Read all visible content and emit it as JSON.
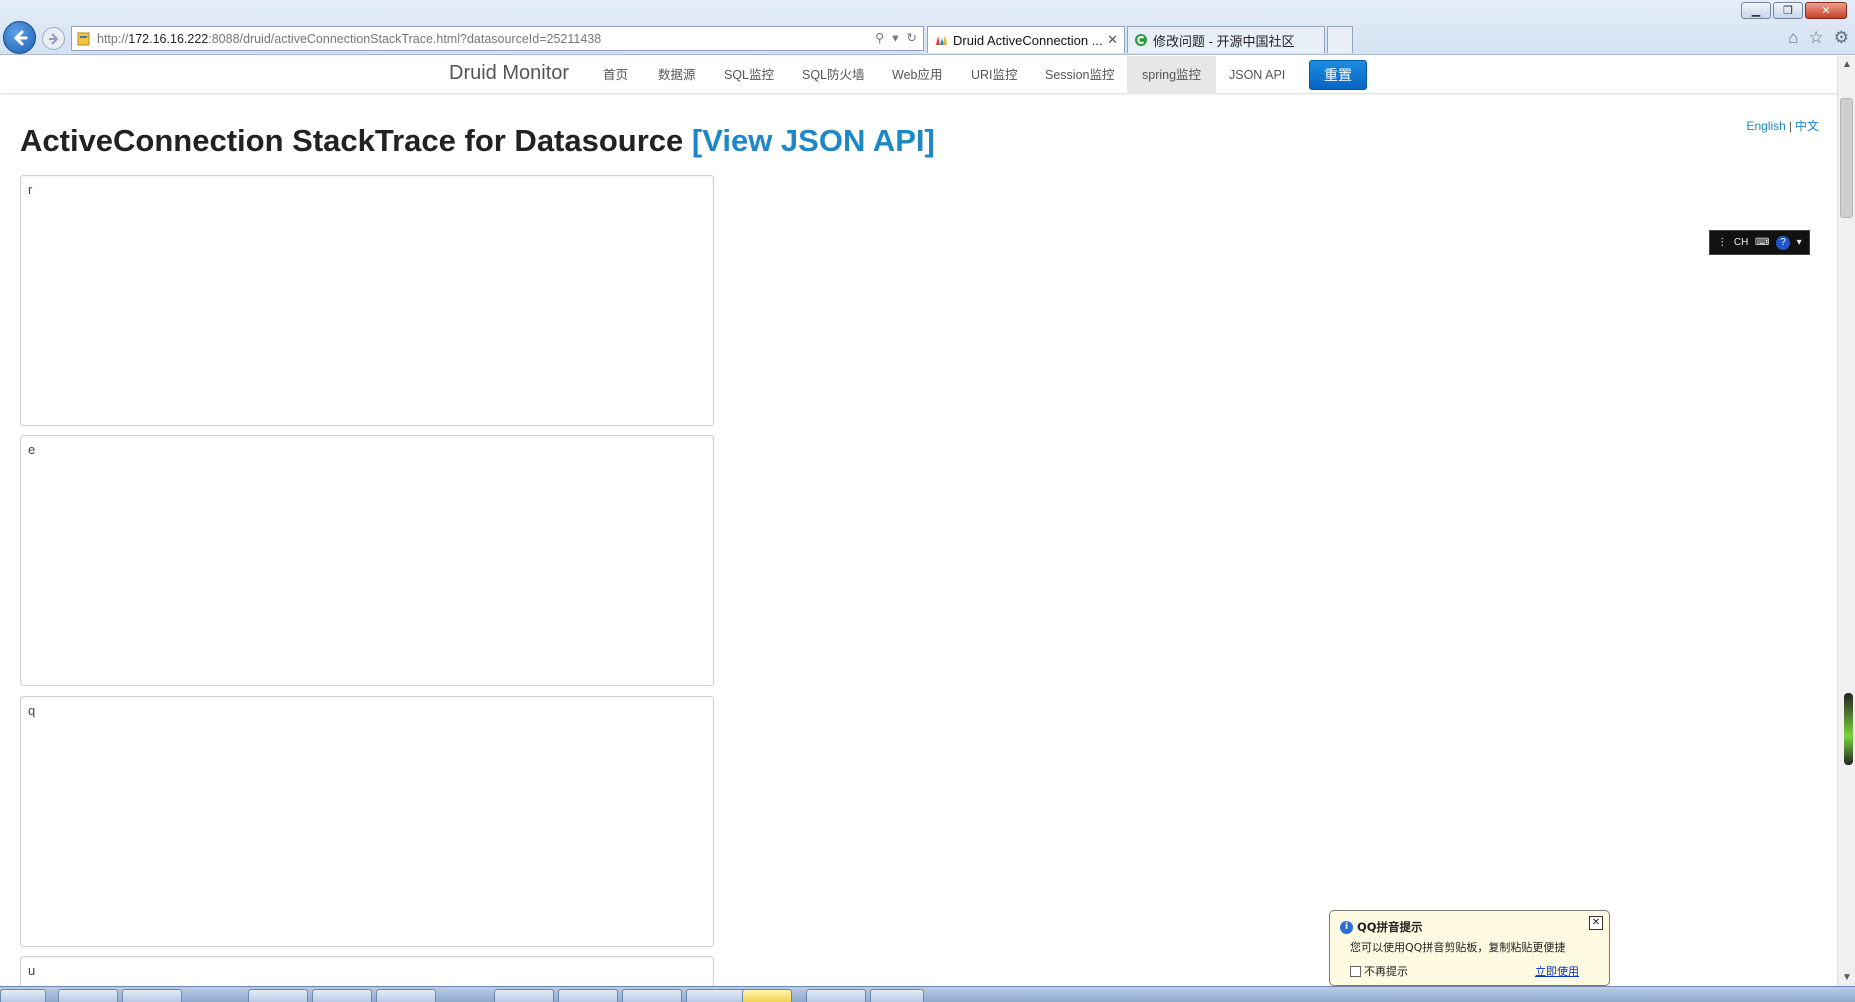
{
  "browser": {
    "url_prefix": "http://",
    "url_host": "172.16.16.222",
    "url_rest": ":8088/druid/activeConnectionStackTrace.html?datasourceId=25211438",
    "tabs": [
      {
        "label": "Druid ActiveConnection ...",
        "active": true
      },
      {
        "label": "修改问题 - 开源中国社区",
        "active": false
      }
    ]
  },
  "navbar": {
    "brand": "Druid Monitor",
    "items": [
      {
        "label": "首页"
      },
      {
        "label": "数据源"
      },
      {
        "label": "SQL监控"
      },
      {
        "label": "SQL防火墙"
      },
      {
        "label": "Web应用"
      },
      {
        "label": "URI监控"
      },
      {
        "label": "Session监控"
      },
      {
        "label": "spring监控",
        "active": true
      },
      {
        "label": "JSON API"
      }
    ],
    "reset_label": "重置",
    "accent_color": "#0a6ed1"
  },
  "lang": {
    "english": "English",
    "separator": "|",
    "chinese": "中文"
  },
  "page": {
    "title": "ActiveConnection StackTrace for Datasource",
    "api_link": "[View JSON API]"
  },
  "stack_traces": [
    {
      "text": "r"
    },
    {
      "text": "e"
    },
    {
      "text": "q"
    },
    {
      "text": "u"
    }
  ],
  "ime": {
    "mode": "CH"
  },
  "qq_popup": {
    "title": "QQ拼音提示",
    "message": "您可以使用QQ拼音剪贴板，复制粘贴更便捷",
    "checkbox_label": "不再提示",
    "action_link": "立即使用"
  }
}
